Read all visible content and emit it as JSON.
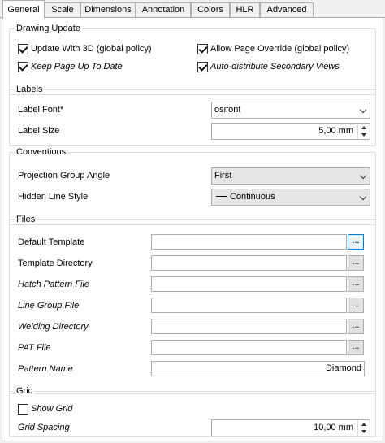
{
  "tabs": [
    {
      "label": "General",
      "active": true
    },
    {
      "label": "Scale",
      "active": false
    },
    {
      "label": "Dimensions",
      "active": false
    },
    {
      "label": "Annotation",
      "active": false
    },
    {
      "label": "Colors",
      "active": false
    },
    {
      "label": "HLR",
      "active": false
    },
    {
      "label": "Advanced",
      "active": false
    }
  ],
  "drawing_update": {
    "title": "Drawing Update",
    "update_with_3d": {
      "label": "Update With 3D (global policy)",
      "checked": true
    },
    "allow_page_override": {
      "label": "Allow Page Override (global policy)",
      "checked": true
    },
    "keep_page_up_to_date": {
      "label": "Keep Page Up To Date",
      "checked": true
    },
    "auto_distribute": {
      "label": "Auto-distribute Secondary Views",
      "checked": true
    }
  },
  "labels": {
    "title": "Labels",
    "font_label": "Label Font*",
    "font_value": "osifont",
    "size_label": "Label Size",
    "size_value": "5,00 mm"
  },
  "conventions": {
    "title": "Conventions",
    "projection_label": "Projection Group Angle",
    "projection_value": "First",
    "hidden_line_label": "Hidden Line Style",
    "hidden_line_value": "Continuous"
  },
  "files": {
    "title": "Files",
    "browse_label": "...",
    "default_template": {
      "label": "Default Template",
      "value": ""
    },
    "template_directory": {
      "label": "Template Directory",
      "value": ""
    },
    "hatch_pattern_file": {
      "label": "Hatch Pattern File",
      "value": ""
    },
    "line_group_file": {
      "label": "Line Group File",
      "value": ""
    },
    "welding_directory": {
      "label": "Welding Directory",
      "value": ""
    },
    "pat_file": {
      "label": "PAT File",
      "value": ""
    },
    "pattern_name": {
      "label": "Pattern Name",
      "value": "Diamond"
    }
  },
  "grid": {
    "title": "Grid",
    "show_grid": {
      "label": "Show Grid",
      "checked": false
    },
    "spacing_label": "Grid Spacing",
    "spacing_value": "10,00 mm"
  }
}
